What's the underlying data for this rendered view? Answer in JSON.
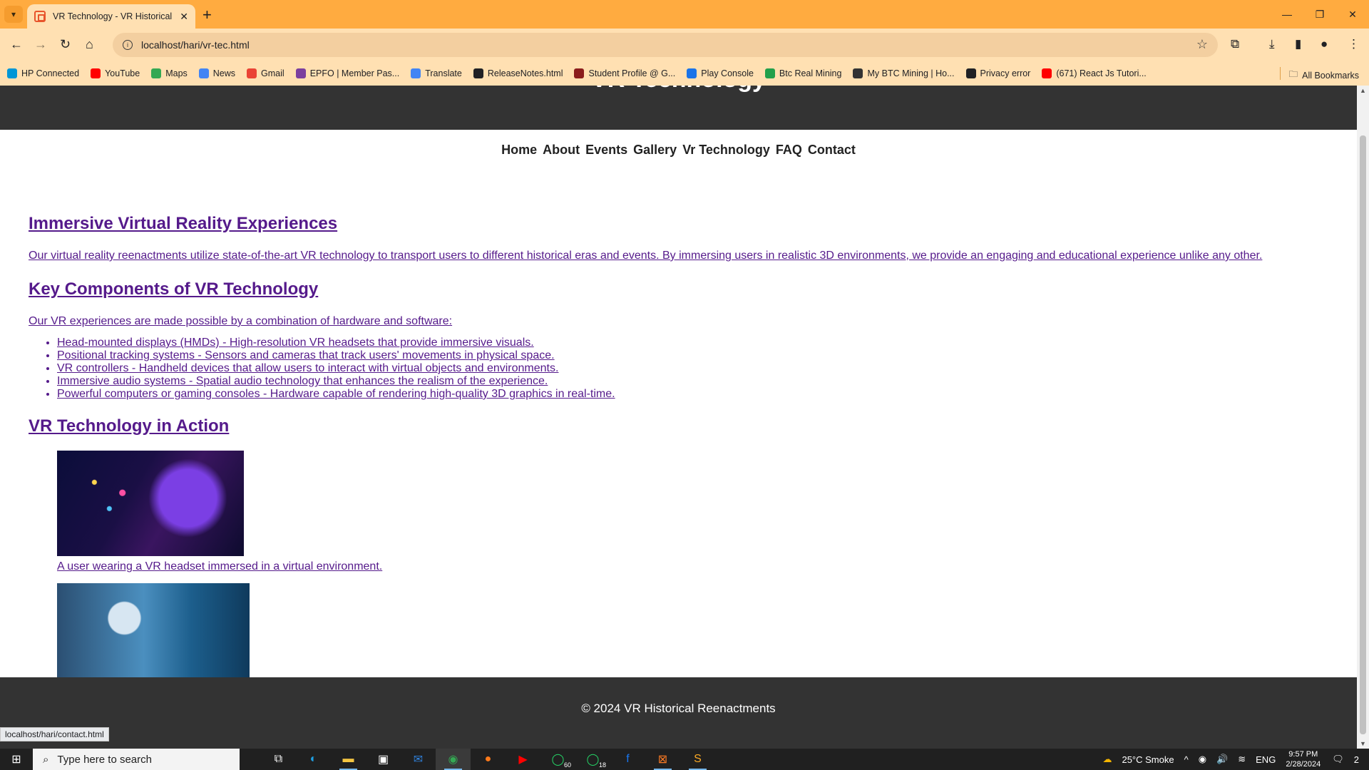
{
  "browser": {
    "tab_title": "VR Technology - VR Historical Reenactments",
    "url": "localhost/hari/vr-tec.html",
    "status_url": "localhost/hari/contact.html",
    "bookmarks": [
      {
        "label": "HP Connected",
        "color": "#0096d6"
      },
      {
        "label": "YouTube",
        "color": "#ff0000"
      },
      {
        "label": "Maps",
        "color": "#34a853"
      },
      {
        "label": "News",
        "color": "#4285f4"
      },
      {
        "label": "Gmail",
        "color": "#ea4335"
      },
      {
        "label": "EPFO | Member Pas...",
        "color": "#7b3f9e"
      },
      {
        "label": "Translate",
        "color": "#4285f4"
      },
      {
        "label": "ReleaseNotes.html",
        "color": "#202124"
      },
      {
        "label": "Student Profile @ G...",
        "color": "#8b1c1c"
      },
      {
        "label": "Play Console",
        "color": "#1a73e8"
      },
      {
        "label": "Btc Real Mining",
        "color": "#22a04b"
      },
      {
        "label": "My BTC Mining | Ho...",
        "color": "#333333"
      },
      {
        "label": "Privacy error",
        "color": "#202124"
      },
      {
        "label": "(671) React Js Tutori...",
        "color": "#ff0000"
      }
    ],
    "all_bookmarks": "All Bookmarks"
  },
  "site": {
    "title": "VR Technology",
    "nav": [
      "Home",
      "About",
      "Events",
      "Gallery",
      "Vr Technology",
      "FAQ",
      "Contact"
    ],
    "sections": {
      "immersive": {
        "heading": "Immersive Virtual Reality Experiences",
        "text": "Our virtual reality reenactments utilize state-of-the-art VR technology to transport users to different historical eras and events. By immersing users in realistic 3D environments, we provide an engaging and educational experience unlike any other."
      },
      "components": {
        "heading": "Key Components of VR Technology",
        "text": "Our VR experiences are made possible by a combination of hardware and software:",
        "items": [
          "Head-mounted displays (HMDs) - High-resolution VR headsets that provide immersive visuals.",
          "Positional tracking systems - Sensors and cameras that track users' movements in physical space.",
          "VR controllers - Handheld devices that allow users to interact with virtual objects and environments.",
          "Immersive audio systems - Spatial audio technology that enhances the realism of the experience.",
          "Powerful computers or gaming consoles - Hardware capable of rendering high-quality 3D graphics in real-time."
        ]
      },
      "action": {
        "heading": "VR Technology in Action",
        "caption1": "A user wearing a VR headset immersed in a virtual environment."
      }
    },
    "footer": "© 2024 VR Historical Reenactments"
  },
  "taskbar": {
    "search_placeholder": "Type here to search",
    "whatsapp_badge_1": "60",
    "whatsapp_badge_2": "18",
    "weather": "25°C  Smoke",
    "language": "ENG",
    "time": "9:57 PM",
    "date": "2/28/2024",
    "notifications": "2"
  }
}
